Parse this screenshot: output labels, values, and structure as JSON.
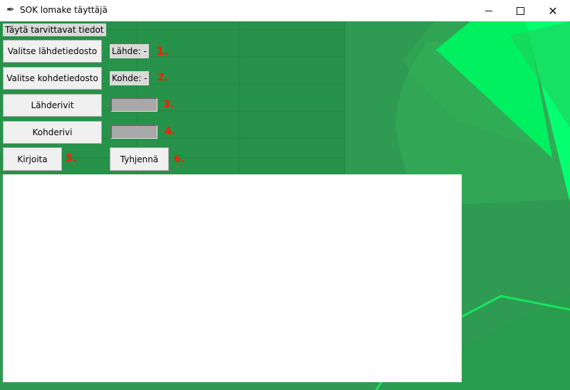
{
  "window": {
    "title": "SOK lomake täyttäjä",
    "minimize_icon": "minimize-icon",
    "maximize_icon": "maximize-icon",
    "close_icon": "close-icon",
    "close_glyph": "✕"
  },
  "form": {
    "header": "Täytä tarvittavat tiedot",
    "source_file_button": "Valitse lähdetiedosto",
    "source_status": "Lähde: -",
    "target_file_button": "Valitse kohdetiedosto",
    "target_status": "Kohde: -",
    "source_rows_button": "Lähderivit",
    "source_rows_value": "",
    "target_row_button": "Kohderivi",
    "target_row_value": "",
    "write_button": "Kirjoita",
    "clear_button": "Tyhjennä",
    "steps": [
      "1.",
      "2.",
      "3.",
      "4.",
      "5.",
      "6."
    ]
  },
  "log": {
    "content": ""
  },
  "colors": {
    "background": "#2e9a52",
    "accent_bright": "#00ff66",
    "step_number": "#ff1a00"
  }
}
